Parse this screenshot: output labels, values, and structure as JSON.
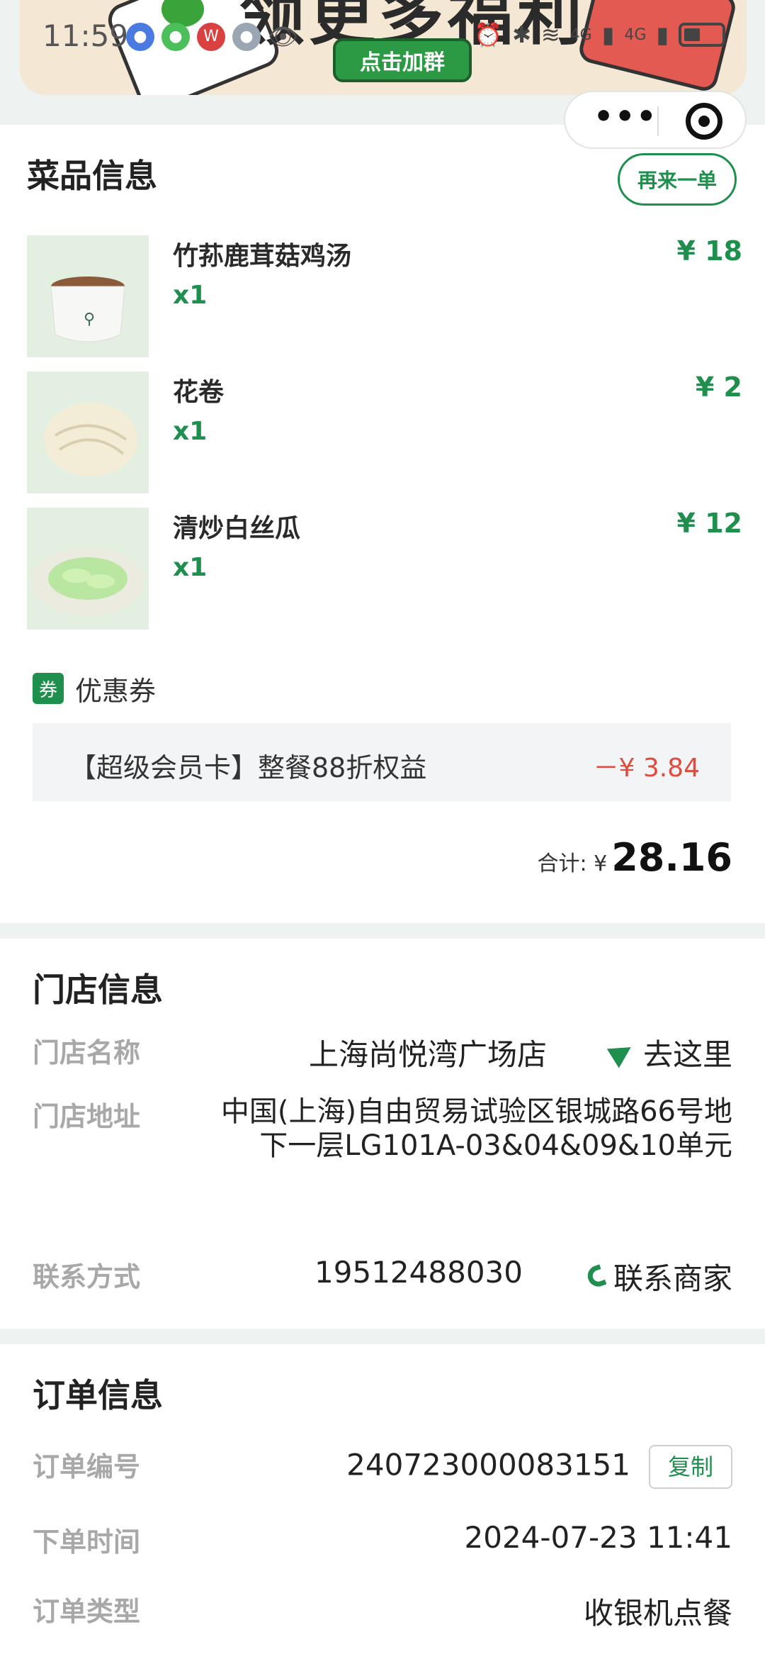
{
  "status_bar": {
    "time": "11:59",
    "signal_labels": [
      "4G",
      "4G"
    ]
  },
  "banner": {
    "title": "领更多福利",
    "join_button": "点击加群"
  },
  "menu_section": {
    "title": "菜品信息",
    "reorder_button": "再来一单",
    "dishes": [
      {
        "name": "竹荪鹿茸菇鸡汤",
        "qty": "x1",
        "price": "¥ 18"
      },
      {
        "name": "花卷",
        "qty": "x1",
        "price": "¥ 2"
      },
      {
        "name": "清炒白丝瓜",
        "qty": "x1",
        "price": "¥ 12"
      }
    ],
    "coupon": {
      "tag": "券",
      "label": "优惠券",
      "name": "【超级会员卡】整餐88折权益",
      "amount": "－¥ 3.84"
    },
    "total": {
      "label": "合计: ¥",
      "value": "28.16"
    }
  },
  "store_section": {
    "title": "门店信息",
    "name_label": "门店名称",
    "name_value": "上海尚悦湾广场店",
    "nav_link": "去这里",
    "address_label": "门店地址",
    "address_value": "中国(上海)自由贸易试验区银城路66号地下一层LG101A-03&04&09&10单元",
    "contact_label": "联系方式",
    "contact_value": "19512488030",
    "contact_link": "联系商家"
  },
  "order_section": {
    "title": "订单信息",
    "number_label": "订单编号",
    "number_value": "240723000083151",
    "copy_button": "复制",
    "time_label": "下单时间",
    "time_value": "2024-07-23 11:41",
    "type_label": "订单类型",
    "type_value": "收银机点餐"
  },
  "colors": {
    "accent_green": "#1f8f4e",
    "discount_red": "#e04b3e",
    "page_bg": "#eef3f2"
  }
}
